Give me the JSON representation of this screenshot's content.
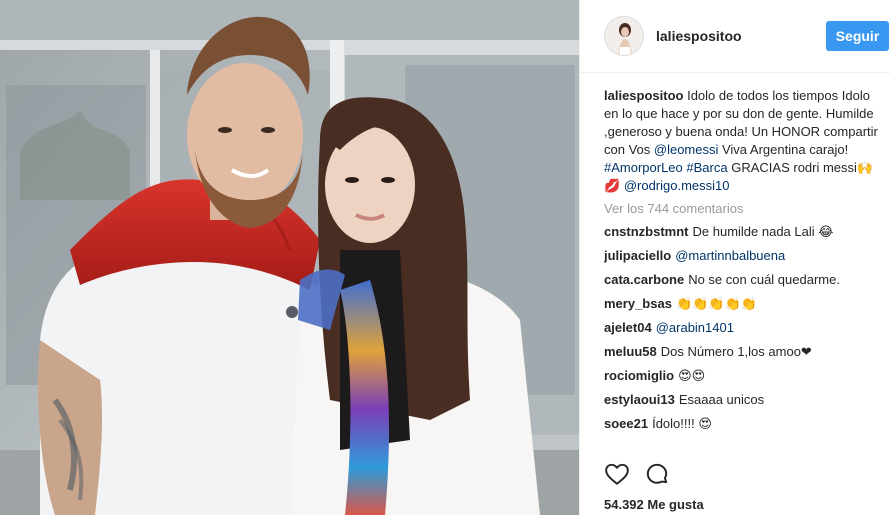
{
  "post": {
    "username": "laliespositoo",
    "follow_label": "Seguir",
    "caption": {
      "text_1": "Idolo de todos los tiempos Idolo en lo que hace y por su don de gente. Humilde ,generoso y buena onda! Un HONOR compartir con Vos ",
      "mention_1": "@leomessi",
      "text_2": " Viva Argentina carajo! ",
      "hashtag_1": "#AmorporLeo",
      "hashtag_2": "#Barca",
      "text_3": "GRACIAS rodri messi🙌💋",
      "mention_2": "@rodrigo.messi10"
    },
    "view_comments": "Ver los 744 comentarios",
    "comments": [
      {
        "user": "cnstnzbstmnt",
        "text": "De humilde nada Lali 😂"
      },
      {
        "user": "julipaciello",
        "text": "@martinnbalbuena",
        "is_mention": true
      },
      {
        "user": "cata.carbone",
        "text": "No se con cuál quedarme."
      },
      {
        "user": "mery_bsas",
        "text": "👏👏👏👏👏"
      },
      {
        "user": "ajelet04",
        "text": "@arabin1401",
        "is_mention": true
      },
      {
        "user": "meluu58",
        "text": "Dos Número 1,los amoo❤"
      },
      {
        "user": "rociomiglio",
        "text": "😍😍"
      },
      {
        "user": "estylaoui13",
        "text": "Esaaaa unicos"
      },
      {
        "user": "soee21",
        "text": "Ídolo!!!! 😍"
      }
    ],
    "likes": "54.392 Me gusta",
    "icons": {
      "like": "heart-icon",
      "comment": "comment-icon"
    },
    "colors": {
      "follow": "#3897f0",
      "link": "#003569",
      "muted": "#999999"
    }
  }
}
